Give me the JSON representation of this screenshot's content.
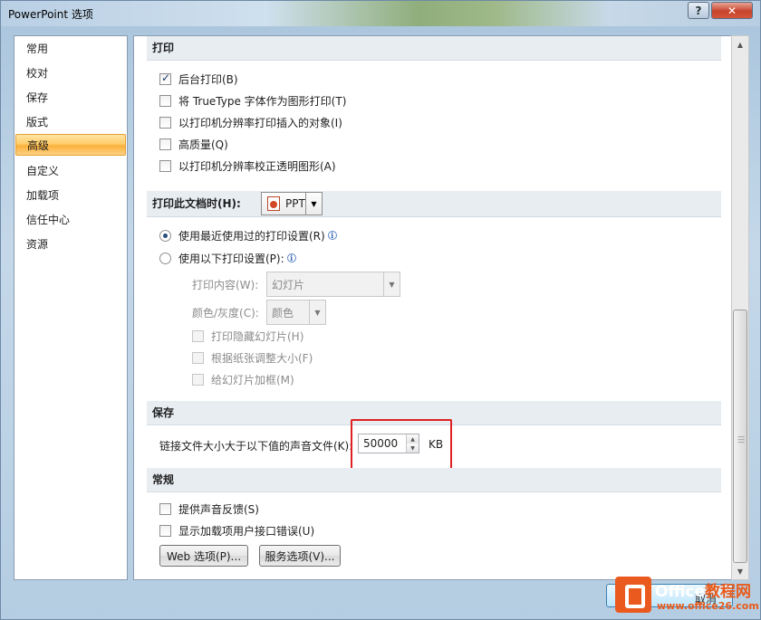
{
  "window": {
    "title": "PowerPoint 选项",
    "help_label": "?",
    "close_label": "✕"
  },
  "nav": {
    "items": [
      {
        "label": "常用"
      },
      {
        "label": "校对"
      },
      {
        "label": "保存"
      },
      {
        "label": "版式"
      },
      {
        "label": "高级",
        "active": true
      },
      {
        "label": "自定义"
      },
      {
        "label": "加载项"
      },
      {
        "label": "信任中心"
      },
      {
        "label": "资源"
      }
    ]
  },
  "print_section": {
    "header": "打印",
    "options": [
      {
        "label": "后台打印(B)",
        "checked": true
      },
      {
        "label": "将 TrueType 字体作为图形打印(T)",
        "checked": false
      },
      {
        "label": "以打印机分辨率打印插入的对象(I)",
        "checked": false
      },
      {
        "label": "高质量(Q)",
        "checked": false
      },
      {
        "label": "以打印机分辨率校正透明图形(A)",
        "checked": false
      }
    ]
  },
  "print_doc_section": {
    "header": "打印此文档时(H):",
    "doc_combo_value": "PPT",
    "radio_recent": "使用最近使用过的打印设置(R)",
    "radio_custom": "使用以下打印设置(P):",
    "print_what_label": "打印内容(W):",
    "print_what_value": "幻灯片",
    "color_label": "颜色/灰度(C):",
    "color_value": "颜色",
    "sub_options": [
      {
        "label": "打印隐藏幻灯片(H)"
      },
      {
        "label": "根据纸张调整大小(F)"
      },
      {
        "label": "给幻灯片加框(M)"
      }
    ]
  },
  "save_section": {
    "header": "保存",
    "link_sound_label": "链接文件大小大于以下值的声音文件(K):",
    "link_sound_value": "50000",
    "unit": "KB"
  },
  "general_section": {
    "header": "常规",
    "options": [
      {
        "label": "提供声音反馈(S)",
        "checked": false
      },
      {
        "label": "显示加载项用户接口错误(U)",
        "checked": false
      }
    ],
    "web_button": "Web 选项(P)...",
    "service_button": "服务选项(V)..."
  },
  "footer": {
    "cancel_label": "取消"
  },
  "watermark": {
    "brand": "Office",
    "brand_suffix": "教程网",
    "url": "www.office26.com"
  },
  "colors": {
    "accent_active": "#fbb13b",
    "highlight": "#e02020",
    "watermark": "#e85b1c"
  }
}
